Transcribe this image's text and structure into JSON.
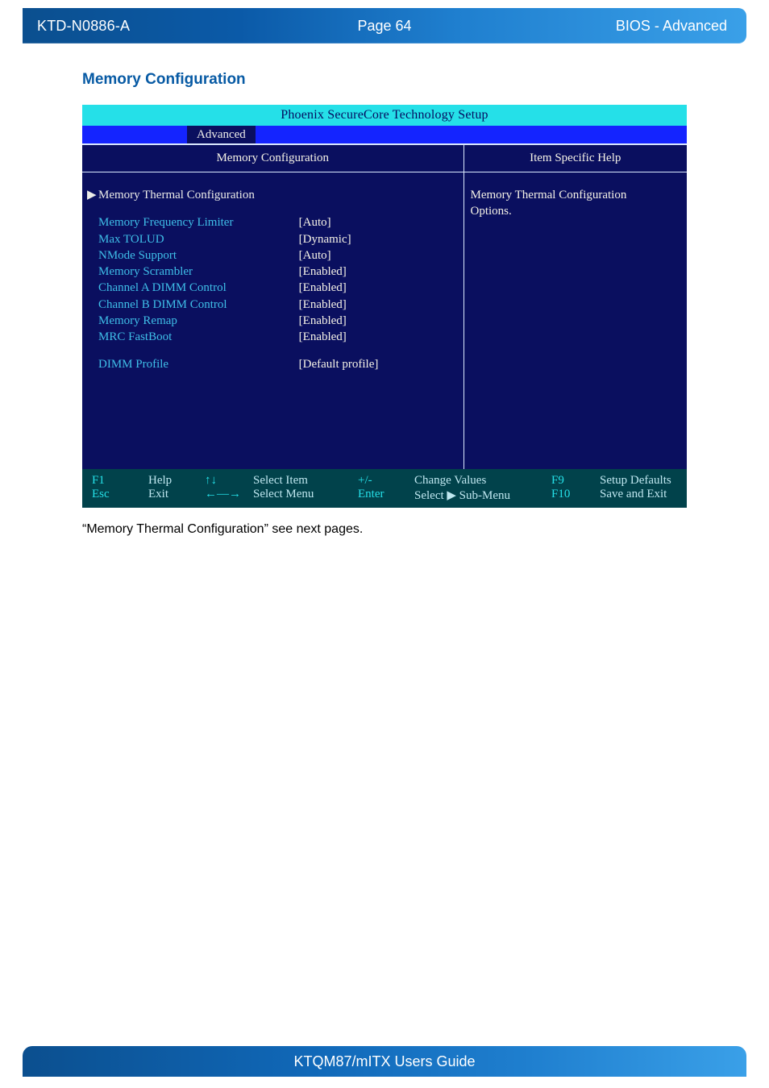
{
  "header": {
    "doc_id": "KTD-N0886-A",
    "page_label": "Page 64",
    "section": "BIOS  - Advanced"
  },
  "section_title": "Memory Configuration",
  "bios": {
    "title": "Phoenix SecureCore Technology Setup",
    "tab": "Advanced",
    "left_header": "Memory Configuration",
    "right_header": "Item Specific Help",
    "submenu": "Memory Thermal Configuration",
    "rows": [
      {
        "label": "Memory Frequency Limiter",
        "value": "[Auto]"
      },
      {
        "label": "Max TOLUD",
        "value": "[Dynamic]"
      },
      {
        "label": "NMode Support",
        "value": "[Auto]"
      },
      {
        "label": "Memory Scrambler",
        "value": "[Enabled]"
      },
      {
        "label": "Channel A DIMM Control",
        "value": "[Enabled]"
      },
      {
        "label": "Channel B DIMM Control",
        "value": "[Enabled]"
      },
      {
        "label": "Memory Remap",
        "value": "[Enabled]"
      },
      {
        "label": "MRC FastBoot",
        "value": "[Enabled]"
      }
    ],
    "profile": {
      "label": "DIMM Profile",
      "value": "[Default profile]"
    },
    "help_text_l1": "Memory Thermal Configuration",
    "help_text_l2": "Options.",
    "footer": {
      "r1": {
        "k1": "F1",
        "t1": "Help",
        "k2": "↑↓",
        "t2": "Select Item",
        "k3": "+/-",
        "t3": "Change Values",
        "k4": "F9",
        "t4": "Setup Defaults"
      },
      "r2": {
        "k1": "Esc",
        "t1": "Exit",
        "k2": "←—→",
        "t2": "Select Menu",
        "k3": "Enter",
        "t3": "Select ▶ Sub-Menu",
        "k4": "F10",
        "t4": "Save and Exit"
      }
    }
  },
  "glyphs": {
    "triangle": "▶"
  },
  "caption": "“Memory Thermal Configuration” see next pages.",
  "footer_title": "KTQM87/mITX Users Guide"
}
